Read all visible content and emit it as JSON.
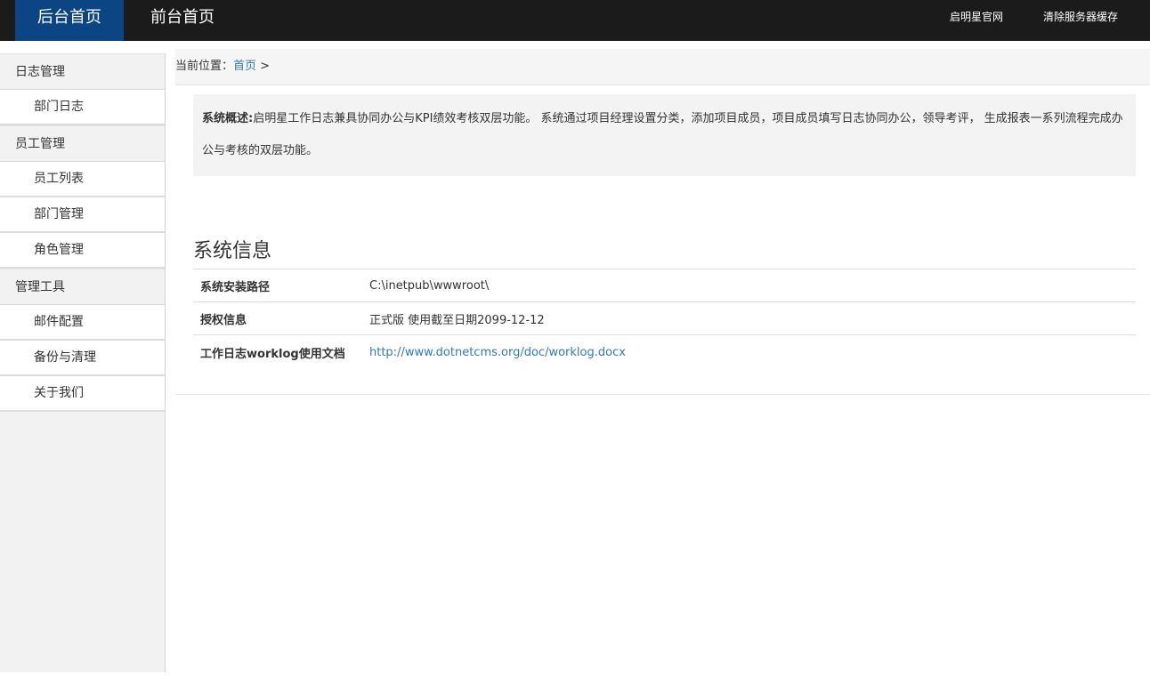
{
  "topbar": {
    "tabs": [
      {
        "label": "后台首页",
        "active": true
      },
      {
        "label": "前台首页",
        "active": false
      }
    ],
    "links": [
      "启明星官网",
      "清除服务器缓存"
    ]
  },
  "sidebar": {
    "groups": [
      {
        "label": "日志管理",
        "items": [
          "部门日志"
        ]
      },
      {
        "label": "员工管理",
        "items": [
          "员工列表",
          "部门管理",
          "角色管理"
        ]
      },
      {
        "label": "管理工具",
        "items": [
          "邮件配置",
          "备份与清理",
          "关于我们"
        ]
      }
    ]
  },
  "breadcrumb": {
    "prefix": "当前位置：",
    "home": "首页",
    "separator": ">"
  },
  "overview": {
    "label": "系统概述:",
    "text": "启明星工作日志兼具协同办公与KPI绩效考核双层功能。 系统通过项目经理设置分类，添加项目成员，项目成员填写日志协同办公，领导考评， 生成报表一系列流程完成办公与考核的双层功能。"
  },
  "system_info": {
    "title": "系统信息",
    "rows": [
      {
        "key": "系统安装路径",
        "value": "C:\\inetpub\\wwwroot\\"
      },
      {
        "key": "授权信息",
        "value": "正式版 使用截至日期2099-12-12"
      },
      {
        "key": "工作日志worklog使用文档",
        "value": "http://www.dotnetcms.org/doc/worklog.docx"
      }
    ]
  },
  "colors": {
    "topbar_bg": "#1b1b1b",
    "active_tab_bg": "#0b4583",
    "link": "#337ab7",
    "sidebar_bg": "#f2f2f2"
  }
}
